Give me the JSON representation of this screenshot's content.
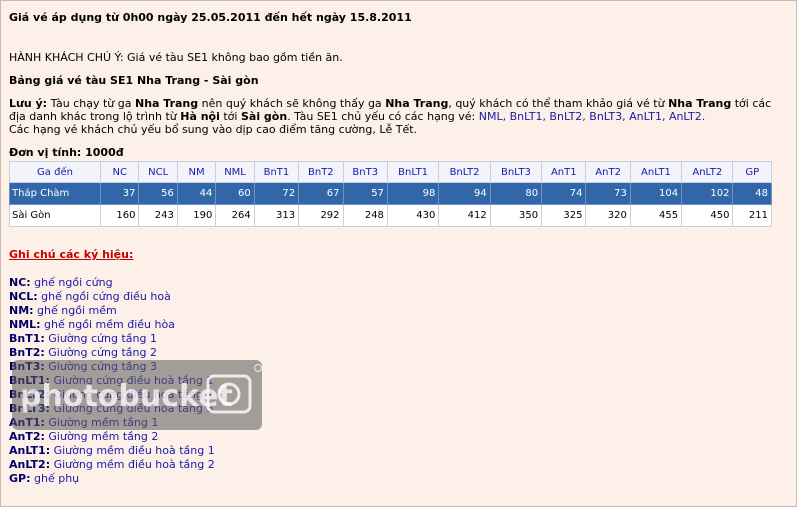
{
  "headline": "Giá vé áp dụng từ 0h00 ngày 25.05.2011 đến hết ngày 15.8.2011",
  "notice": "HÀNH KHÁCH CHÚ Ý: Giá vé tàu SE1 không bao gồm tiền ăn.",
  "table_title": "Bảng giá vé tàu SE1  Nha Trang - Sài gòn",
  "note": {
    "label": "Lưu ý:",
    "t1": " Tàu chạy từ ga ",
    "s1": "Nha Trang",
    "t2": " nên quý khách sẽ không thấy ga ",
    "s2": "Nha Trang",
    "t3": ", quý khách có thể tham khảo giá vé từ ",
    "s3": "Nha Trang",
    "t4": " tới các địa danh khác trong lộ trình từ ",
    "s4": "Hà nội",
    "t5": " tới ",
    "s5": "Sài gòn",
    "t6": ". Tàu SE1 chủ yếu có các hạng vé: ",
    "kinds": "NML, BnLT1, BnLT2, BnLT3, AnLT1, AnLT2.",
    "t7": "Các hạng vé khách chủ yếu bổ sung vào dịp cao điểm tăng cường, Lễ Tết."
  },
  "unit": "Đơn vị tính: 1000đ",
  "table": {
    "headers": [
      "Ga đến",
      "NC",
      "NCL",
      "NM",
      "NML",
      "BnT1",
      "BnT2",
      "BnT3",
      "BnLT1",
      "BnLT2",
      "BnLT3",
      "AnT1",
      "AnT2",
      "AnLT1",
      "AnLT2",
      "GP"
    ],
    "rows": [
      {
        "station": "Tháp Chàm",
        "values": [
          "37",
          "56",
          "44",
          "60",
          "72",
          "67",
          "57",
          "98",
          "94",
          "80",
          "74",
          "73",
          "104",
          "102",
          "48"
        ]
      },
      {
        "station": "Sài Gòn",
        "values": [
          "160",
          "243",
          "190",
          "264",
          "313",
          "292",
          "248",
          "430",
          "412",
          "350",
          "325",
          "320",
          "455",
          "450",
          "211"
        ]
      }
    ]
  },
  "legend_title": "Ghi chú các ký hiệu:",
  "legend": [
    {
      "code": "NC:",
      "desc": " ghế ngồi cứng"
    },
    {
      "code": "NCL:",
      "desc": " ghế ngồi cứng điều hoà"
    },
    {
      "code": "NM:",
      "desc": " ghế ngồi mềm"
    },
    {
      "code": "NML:",
      "desc": " ghế ngồi mềm điều hòa"
    },
    {
      "code": "BnT1:",
      "desc": " Giường cứng tầng 1"
    },
    {
      "code": "BnT2:",
      "desc": " Giường cứng tầng 2"
    },
    {
      "code": "BnT3:",
      "desc": " Giường cứng tầng 3"
    },
    {
      "code": "BnLT1:",
      "desc": " Giường cứng điều hoà tầng 1"
    },
    {
      "code": "BnLT2:",
      "desc": " Giường cứng điều hoà tầng 2"
    },
    {
      "code": "BnLT3:",
      "desc": " Giường cứng điều hoà tầng 3"
    },
    {
      "code": "AnT1:",
      "desc": " Giường mềm tầng 1"
    },
    {
      "code": "AnT2:",
      "desc": " Giường mềm tầng 2"
    },
    {
      "code": "AnLT1:",
      "desc": " Giường mềm điều hoà tầng 1"
    },
    {
      "code": "AnLT2:",
      "desc": " Giường mềm điều hoà tầng 2"
    },
    {
      "code": "GP:",
      "desc": " ghế phụ"
    }
  ],
  "watermark_text": "photobucket",
  "colors": {
    "background": "#fdf0e8",
    "link_blue": "#1a1aa6",
    "selected_row": "#3166a8",
    "legend_title_red": "#c40000"
  }
}
